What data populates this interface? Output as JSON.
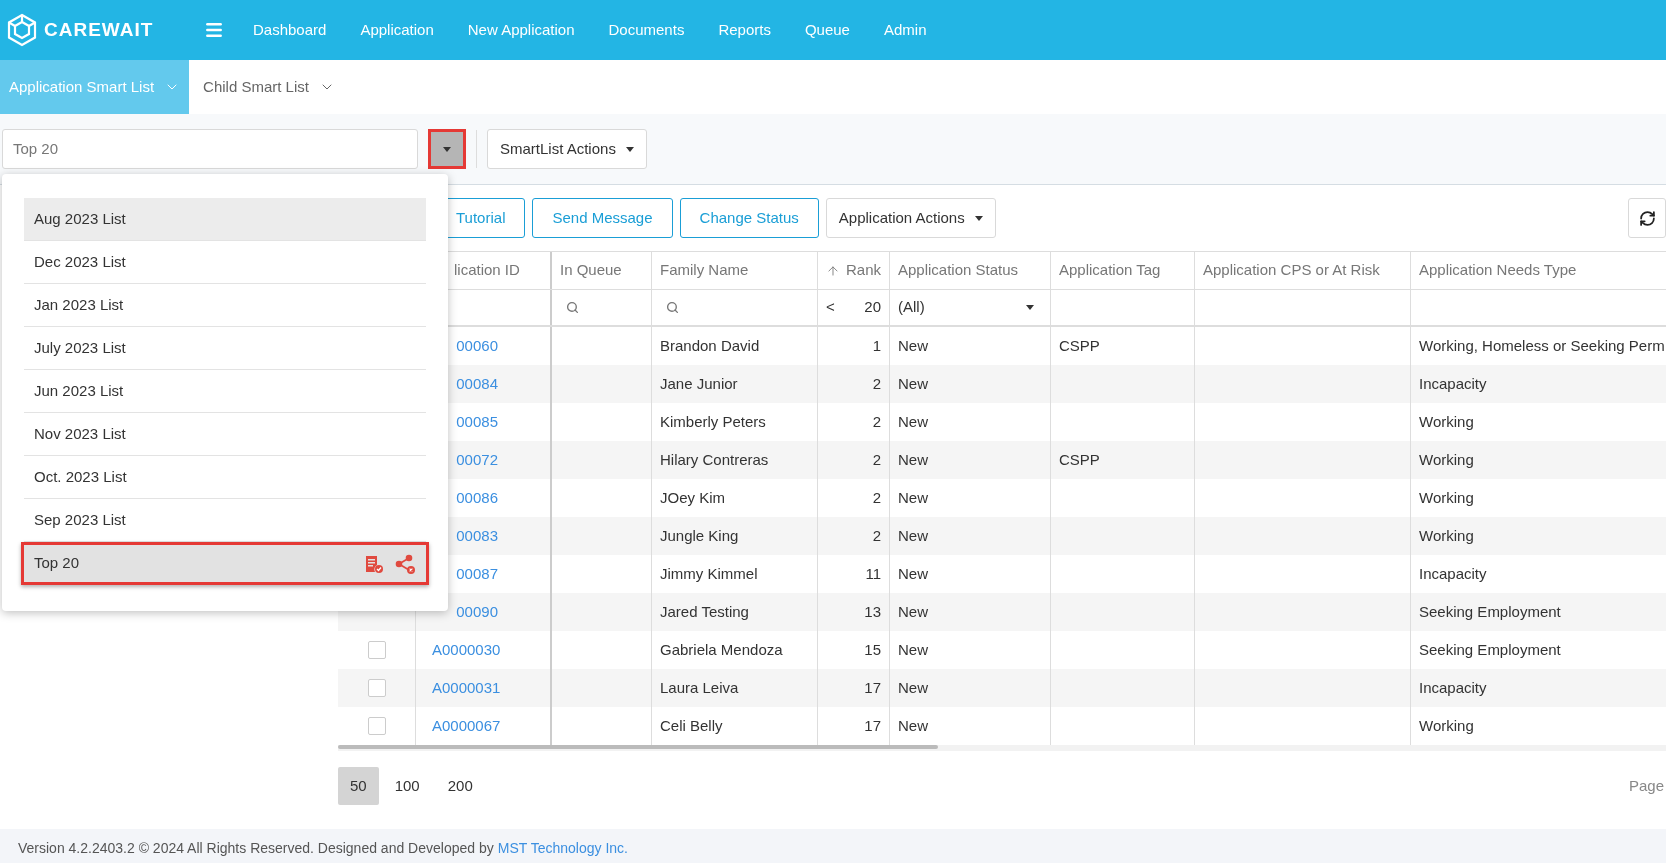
{
  "header": {
    "logo": "CAREWAIT",
    "nav": [
      "Dashboard",
      "Application",
      "New Application",
      "Documents",
      "Reports",
      "Queue",
      "Admin"
    ]
  },
  "subnav": [
    {
      "label": "Application Smart List",
      "selected": true
    },
    {
      "label": "Child Smart List",
      "selected": false
    }
  ],
  "smartlist": {
    "value": "Top 20",
    "actions": "SmartList Actions",
    "items": [
      {
        "label": "Aug 2023 List",
        "highlighted": true,
        "selected": false
      },
      {
        "label": "Dec 2023 List",
        "highlighted": false,
        "selected": false
      },
      {
        "label": "Jan 2023 List",
        "highlighted": false,
        "selected": false
      },
      {
        "label": "July 2023 List",
        "highlighted": false,
        "selected": false
      },
      {
        "label": "Jun 2023 List",
        "highlighted": false,
        "selected": false
      },
      {
        "label": "Nov 2023 List",
        "highlighted": false,
        "selected": false
      },
      {
        "label": "Oct. 2023 List",
        "highlighted": false,
        "selected": false
      },
      {
        "label": "Sep 2023 List",
        "highlighted": false,
        "selected": false
      },
      {
        "label": "Top 20",
        "highlighted": false,
        "selected": true
      }
    ]
  },
  "toolbar": {
    "buttons": [
      "Tutorial",
      "Send Message",
      "Change Status"
    ],
    "actions": "Application Actions"
  },
  "table": {
    "columns": [
      {
        "label": "lication ID"
      },
      {
        "label": "In Queue"
      },
      {
        "label": "Family Name"
      },
      {
        "label": "Rank",
        "sorted": true
      },
      {
        "label": "Application Status"
      },
      {
        "label": "Application Tag"
      },
      {
        "label": "Application CPS or At Risk"
      },
      {
        "label": "Application Needs Type"
      }
    ],
    "filters": {
      "rank_operator": "<",
      "rank_value": "20",
      "status": "(All)"
    },
    "rows": [
      {
        "id": "00060",
        "family": "Brandon David",
        "rank": "1",
        "status": "New",
        "tag": "CSPP",
        "needs": "Working, Homeless or Seeking Perm"
      },
      {
        "id": "00084",
        "family": "Jane Junior",
        "rank": "2",
        "status": "New",
        "needs": "Incapacity"
      },
      {
        "id": "00085",
        "family": "Kimberly Peters",
        "rank": "2",
        "status": "New",
        "needs": "Working"
      },
      {
        "id": "00072",
        "family": "Hilary Contreras",
        "rank": "2",
        "status": "New",
        "tag": "CSPP",
        "needs": "Working"
      },
      {
        "id": "00086",
        "family": "JOey Kim",
        "rank": "2",
        "status": "New",
        "needs": "Working"
      },
      {
        "id": "00083",
        "family": "Jungle King",
        "rank": "2",
        "status": "New",
        "needs": "Working"
      },
      {
        "id": "00087",
        "family": "Jimmy Kimmel",
        "rank": "11",
        "status": "New",
        "needs": "Incapacity"
      },
      {
        "id": "00090",
        "family": "Jared Testing",
        "rank": "13",
        "status": "New",
        "needs": "Seeking Employment"
      },
      {
        "id": "A0000030",
        "family": "Gabriela Mendoza",
        "rank": "15",
        "status": "New",
        "needs": "Seeking Employment",
        "checked": false
      },
      {
        "id": "A0000031",
        "family": "Laura Leiva",
        "rank": "17",
        "status": "New",
        "needs": "Incapacity",
        "checked": false
      },
      {
        "id": "A0000067",
        "family": "Celi Belly",
        "rank": "17",
        "status": "New",
        "needs": "Working",
        "checked": false
      }
    ]
  },
  "pager": {
    "sizes": [
      {
        "label": "50",
        "selected": true
      },
      {
        "label": "100",
        "selected": false
      },
      {
        "label": "200",
        "selected": false
      }
    ],
    "page_label": "Page"
  },
  "footer": {
    "text": "Version 4.2.2403.2 © 2024 All Rights Reserved. Designed and Developed by",
    "link": "MST Technology Inc."
  }
}
